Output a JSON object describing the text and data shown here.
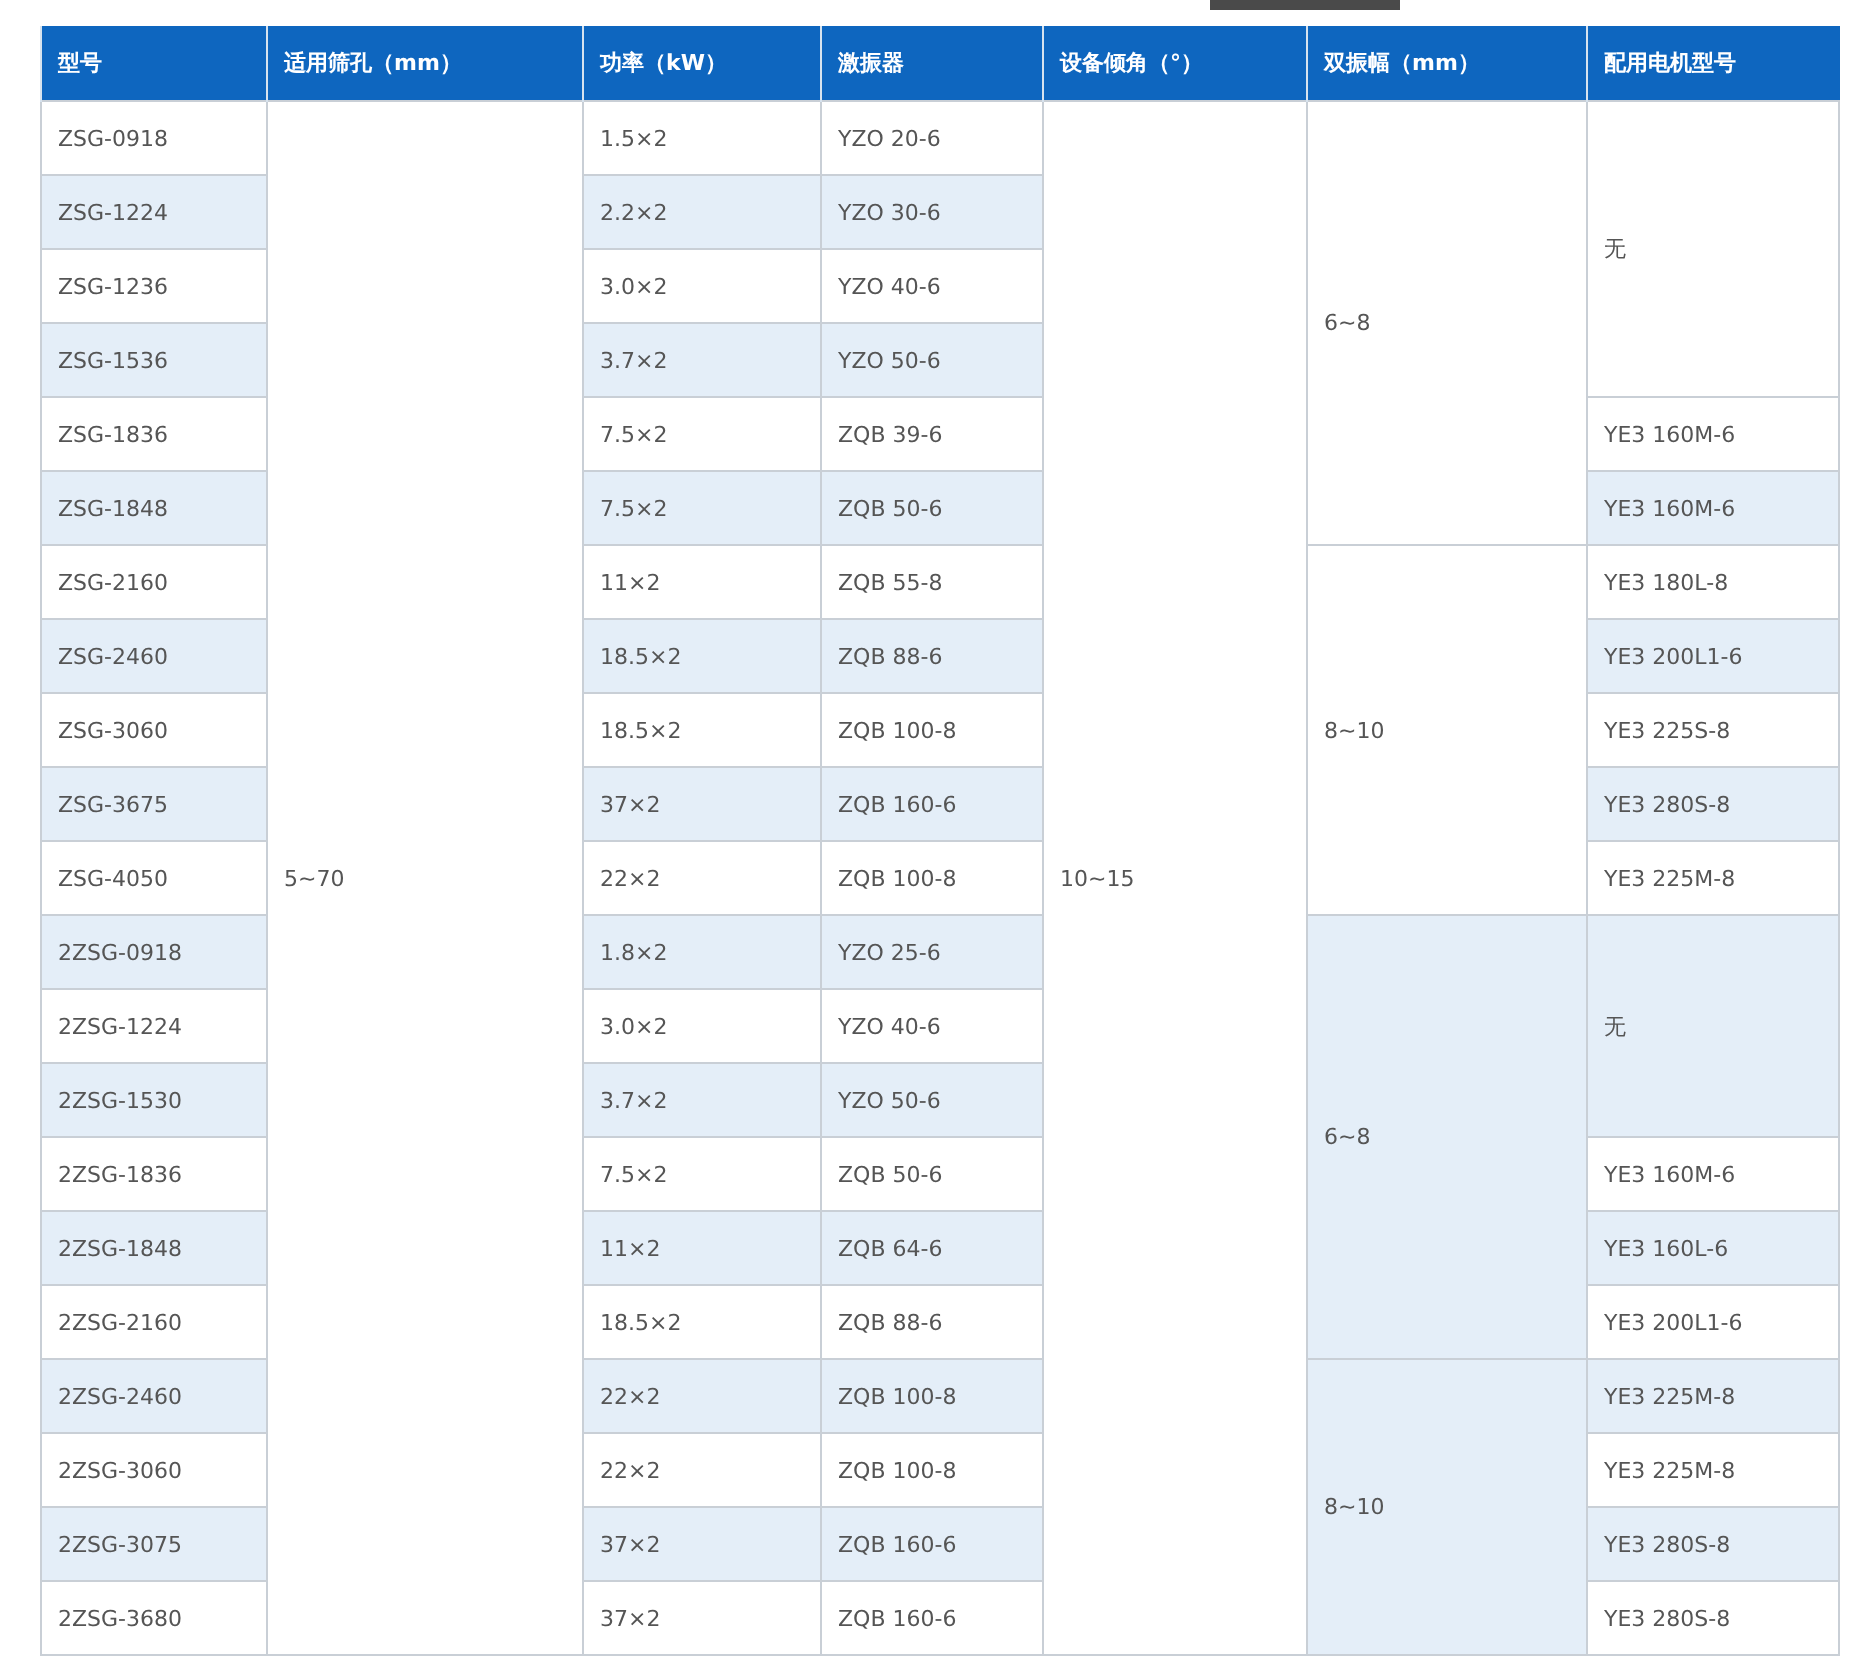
{
  "table": {
    "columns": [
      "型号",
      "适用筛孔（mm）",
      "功率（kW）",
      "激振器",
      "设备倾角（°）",
      "双振幅（mm）",
      "配用电机型号"
    ],
    "rows": [
      {
        "model": "ZSG-0918",
        "aperture": "5~70",
        "power": "1.5×2",
        "exciter": "YZO 20-6",
        "angle": "10~15",
        "amplitude": "6~8",
        "motor": "无"
      },
      {
        "model": "ZSG-1224",
        "power": "2.2×2",
        "exciter": "YZO 30-6"
      },
      {
        "model": "ZSG-1236",
        "power": "3.0×2",
        "exciter": "YZO 40-6"
      },
      {
        "model": "ZSG-1536",
        "power": "3.7×2",
        "exciter": "YZO 50-6"
      },
      {
        "model": "ZSG-1836",
        "power": "7.5×2",
        "exciter": "ZQB 39-6",
        "motor": "YE3 160M-6"
      },
      {
        "model": "ZSG-1848",
        "power": "7.5×2",
        "exciter": "ZQB 50-6",
        "motor": "YE3 160M-6"
      },
      {
        "model": "ZSG-2160",
        "power": "11×2",
        "exciter": "ZQB 55-8",
        "amplitude": "8~10",
        "motor": "YE3 180L-8"
      },
      {
        "model": "ZSG-2460",
        "power": "18.5×2",
        "exciter": "ZQB 88-6",
        "motor": "YE3 200L1-6"
      },
      {
        "model": "ZSG-3060",
        "power": "18.5×2",
        "exciter": "ZQB 100-8",
        "motor": "YE3 225S-8"
      },
      {
        "model": "ZSG-3675",
        "power": "37×2",
        "exciter": "ZQB 160-6",
        "motor": "YE3 280S-8"
      },
      {
        "model": "ZSG-4050",
        "power": "22×2",
        "exciter": "ZQB 100-8",
        "motor": "YE3 225M-8"
      },
      {
        "model": "2ZSG-0918",
        "power": "1.8×2",
        "exciter": "YZO 25-6",
        "amplitude": "6~8",
        "motor": "无"
      },
      {
        "model": "2ZSG-1224",
        "power": "3.0×2",
        "exciter": "YZO 40-6"
      },
      {
        "model": "2ZSG-1530",
        "power": "3.7×2",
        "exciter": "YZO 50-6"
      },
      {
        "model": "2ZSG-1836",
        "power": "7.5×2",
        "exciter": "ZQB 50-6",
        "motor": "YE3 160M-6"
      },
      {
        "model": "2ZSG-1848",
        "power": "11×2",
        "exciter": "ZQB 64-6",
        "motor": "YE3 160L-6"
      },
      {
        "model": "2ZSG-2160",
        "power": "18.5×2",
        "exciter": "ZQB 88-6",
        "motor": "YE3 200L1-6"
      },
      {
        "model": "2ZSG-2460",
        "power": "22×2",
        "exciter": "ZQB 100-8",
        "amplitude": "8~10",
        "motor": "YE3 225M-8"
      },
      {
        "model": "2ZSG-3060",
        "power": "22×2",
        "exciter": "ZQB 100-8",
        "motor": "YE3 225M-8"
      },
      {
        "model": "2ZSG-3075",
        "power": "37×2",
        "exciter": "ZQB 160-6",
        "motor": "YE3 280S-8"
      },
      {
        "model": "2ZSG-3680",
        "power": "37×2",
        "exciter": "ZQB 160-6",
        "motor": "YE3 280S-8"
      }
    ]
  }
}
